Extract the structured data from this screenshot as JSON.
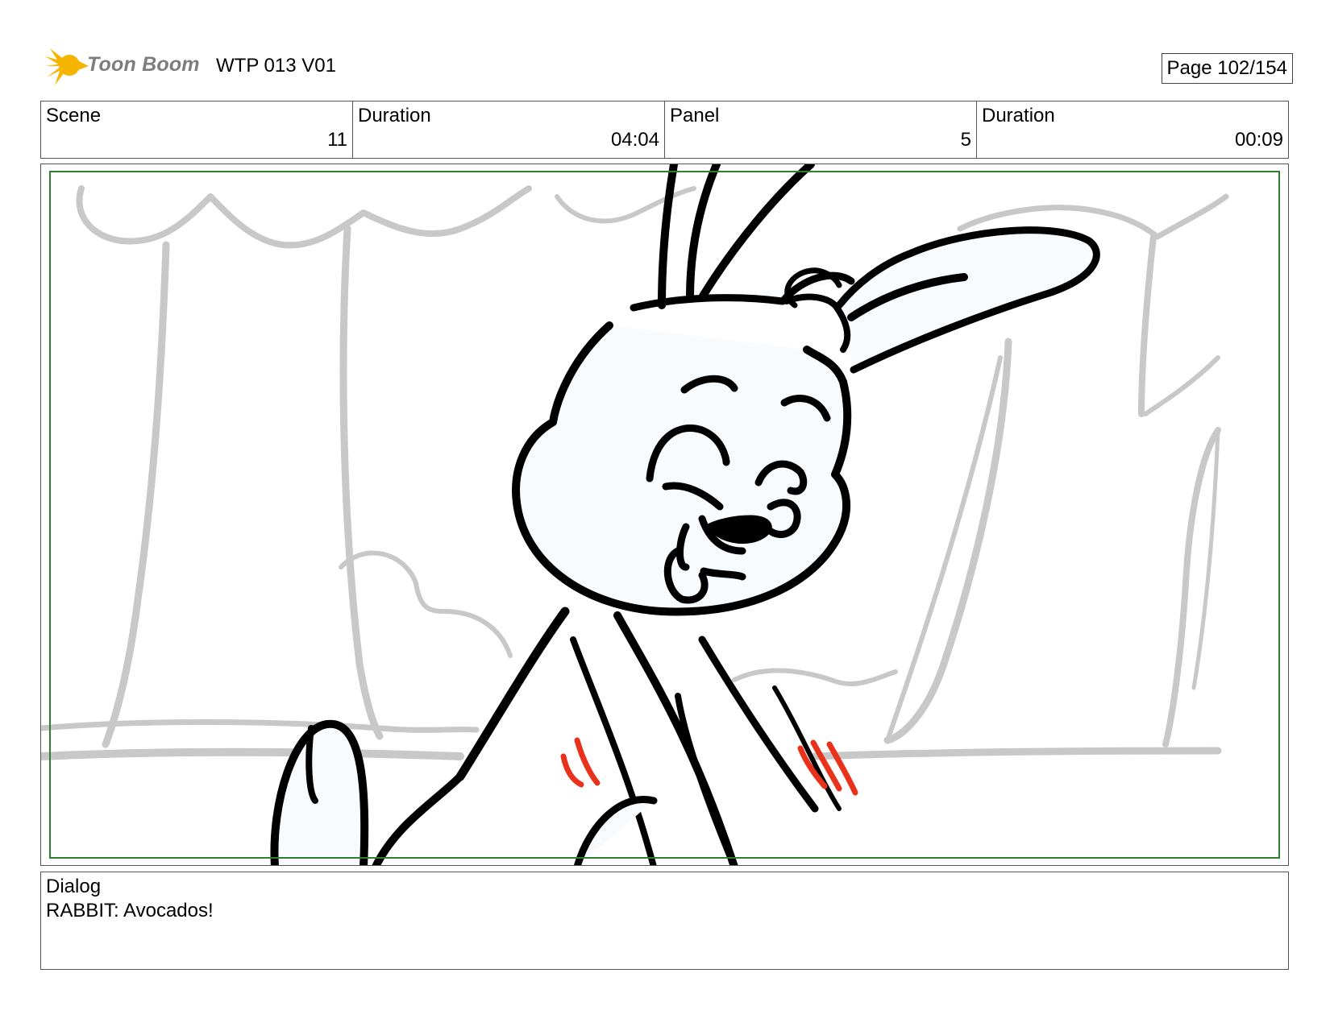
{
  "header": {
    "logo_text": "Toon Boom",
    "title": "WTP 013 V01",
    "page": "Page 102/154"
  },
  "info": {
    "scene_label": "Scene",
    "scene_value": "11",
    "scene_duration_label": "Duration",
    "scene_duration_value": "04:04",
    "panel_label": "Panel",
    "panel_value": "5",
    "panel_duration_label": "Duration",
    "panel_duration_value": "00:09"
  },
  "dialog": {
    "label": "Dialog",
    "text": "RABBIT: Avocados!"
  },
  "colors": {
    "logo_star": "#f5b400",
    "logo_text": "#7d7d7d",
    "safe_frame": "#2e7d32",
    "sketch_gray": "#c8c8c8",
    "action_lines": "#e8321c"
  }
}
